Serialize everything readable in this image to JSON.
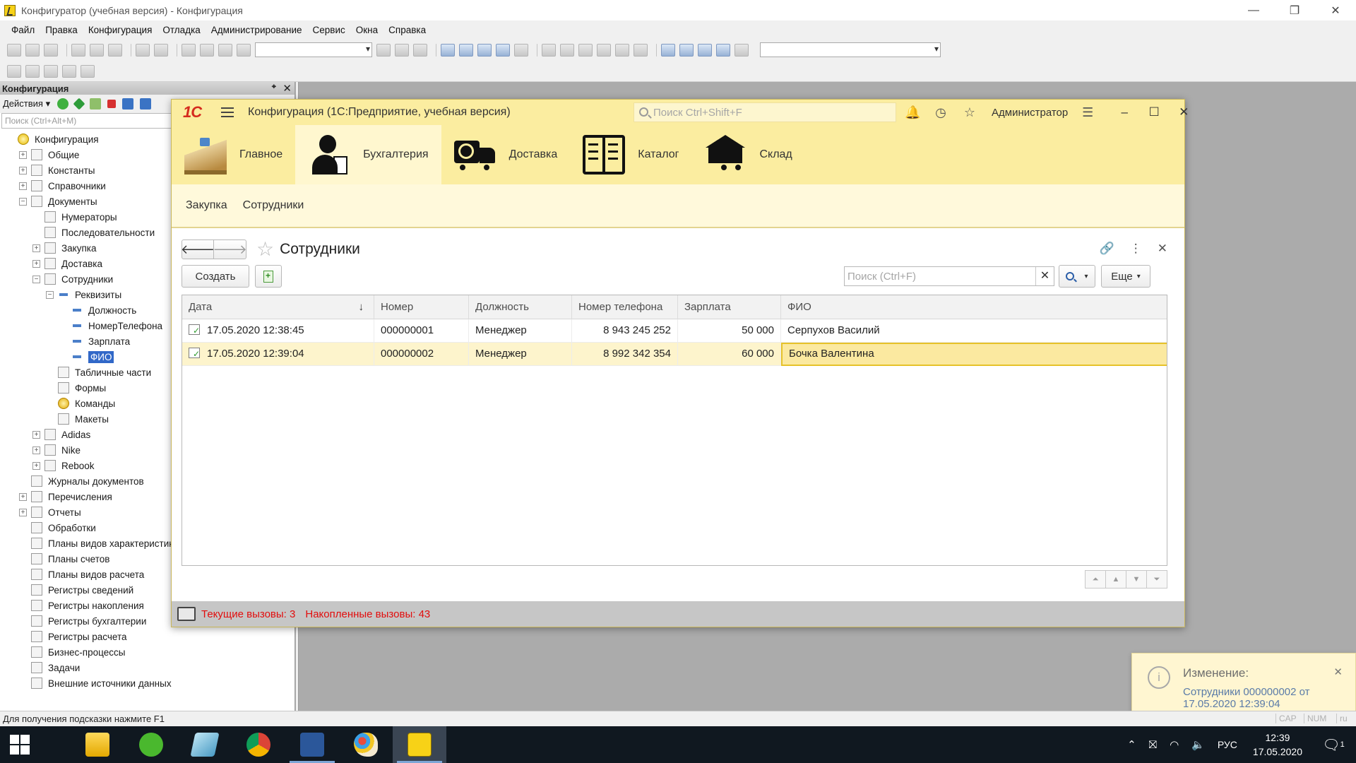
{
  "window": {
    "title": "Конфигуратор (учебная версия) - Конфигурация",
    "min": "—",
    "max": "❐",
    "close": "✕"
  },
  "menu": [
    "Файл",
    "Правка",
    "Конфигурация",
    "Отладка",
    "Администрирование",
    "Сервис",
    "Окна",
    "Справка"
  ],
  "config_panel": {
    "title": "Конфигурация",
    "actions_label": "Действия",
    "search_placeholder": "Поиск (Ctrl+Alt+M)",
    "tree": [
      {
        "label": "Конфигурация",
        "level": 0,
        "exp": "",
        "icon": "root"
      },
      {
        "label": "Общие",
        "level": 1,
        "exp": "+",
        "icon": "generic"
      },
      {
        "label": "Константы",
        "level": 1,
        "exp": "+",
        "icon": "generic"
      },
      {
        "label": "Справочники",
        "level": 1,
        "exp": "+",
        "icon": "generic"
      },
      {
        "label": "Документы",
        "level": 1,
        "exp": "−",
        "icon": "generic"
      },
      {
        "label": "Нумераторы",
        "level": 2,
        "exp": "",
        "icon": "generic"
      },
      {
        "label": "Последовательности",
        "level": 2,
        "exp": "",
        "icon": "generic"
      },
      {
        "label": "Закупка",
        "level": 2,
        "exp": "+",
        "icon": "generic"
      },
      {
        "label": "Доставка",
        "level": 2,
        "exp": "+",
        "icon": "generic"
      },
      {
        "label": "Сотрудники",
        "level": 2,
        "exp": "−",
        "icon": "generic"
      },
      {
        "label": "Реквизиты",
        "level": 3,
        "exp": "−",
        "icon": "dash"
      },
      {
        "label": "Должность",
        "level": 4,
        "exp": "",
        "icon": "dash"
      },
      {
        "label": "НомерТелефона",
        "level": 4,
        "exp": "",
        "icon": "dash"
      },
      {
        "label": "Зарплата",
        "level": 4,
        "exp": "",
        "icon": "dash"
      },
      {
        "label": "ФИО",
        "level": 4,
        "exp": "",
        "icon": "dash",
        "selected": true
      },
      {
        "label": "Табличные части",
        "level": 3,
        "exp": "",
        "icon": "generic"
      },
      {
        "label": "Формы",
        "level": 3,
        "exp": "",
        "icon": "generic"
      },
      {
        "label": "Команды",
        "level": 3,
        "exp": "",
        "icon": "cmd"
      },
      {
        "label": "Макеты",
        "level": 3,
        "exp": "",
        "icon": "generic"
      },
      {
        "label": "Adidas",
        "level": 2,
        "exp": "+",
        "icon": "generic"
      },
      {
        "label": "Nike",
        "level": 2,
        "exp": "+",
        "icon": "generic"
      },
      {
        "label": "Rebook",
        "level": 2,
        "exp": "+",
        "icon": "generic"
      },
      {
        "label": "Журналы документов",
        "level": 1,
        "exp": "",
        "icon": "generic"
      },
      {
        "label": "Перечисления",
        "level": 1,
        "exp": "+",
        "icon": "generic"
      },
      {
        "label": "Отчеты",
        "level": 1,
        "exp": "+",
        "icon": "generic"
      },
      {
        "label": "Обработки",
        "level": 1,
        "exp": "",
        "icon": "generic"
      },
      {
        "label": "Планы видов характеристик",
        "level": 1,
        "exp": "",
        "icon": "generic"
      },
      {
        "label": "Планы счетов",
        "level": 1,
        "exp": "",
        "icon": "generic"
      },
      {
        "label": "Планы видов расчета",
        "level": 1,
        "exp": "",
        "icon": "generic"
      },
      {
        "label": "Регистры сведений",
        "level": 1,
        "exp": "",
        "icon": "generic"
      },
      {
        "label": "Регистры накопления",
        "level": 1,
        "exp": "",
        "icon": "generic"
      },
      {
        "label": "Регистры бухгалтерии",
        "level": 1,
        "exp": "",
        "icon": "generic"
      },
      {
        "label": "Регистры расчета",
        "level": 1,
        "exp": "",
        "icon": "generic"
      },
      {
        "label": "Бизнес-процессы",
        "level": 1,
        "exp": "",
        "icon": "generic"
      },
      {
        "label": "Задачи",
        "level": 1,
        "exp": "",
        "icon": "generic"
      },
      {
        "label": "Внешние источники данных",
        "level": 1,
        "exp": "",
        "icon": "generic"
      }
    ]
  },
  "enterprise": {
    "logo": "1С",
    "title": "Конфигурация  (1С:Предприятие, учебная версия)",
    "search_placeholder": "Поиск Ctrl+Shift+F",
    "user": "Администратор",
    "sections": [
      {
        "label": "Главное",
        "icon": "home"
      },
      {
        "label": "Бухгалтерия",
        "icon": "acc",
        "active": true
      },
      {
        "label": "Доставка",
        "icon": "truck"
      },
      {
        "label": "Каталог",
        "icon": "book"
      },
      {
        "label": "Склад",
        "icon": "wh"
      }
    ],
    "subnav": [
      "Закупка",
      "Сотрудники"
    ],
    "form": {
      "title": "Сотрудники",
      "create_label": "Создать",
      "search_placeholder": "Поиск (Ctrl+F)",
      "more_label": "Еще",
      "columns": [
        "Дата",
        "Номер",
        "Должность",
        "Номер телефона",
        "Зарплата",
        "ФИО"
      ],
      "rows": [
        {
          "date": "17.05.2020 12:38:45",
          "number": "000000001",
          "position": "Менеджер",
          "phone": "8 943 245 252",
          "salary": "50 000",
          "fio": "Серпухов Василий"
        },
        {
          "date": "17.05.2020 12:39:04",
          "number": "000000002",
          "position": "Менеджер",
          "phone": "8 992 342 354",
          "salary": "60 000",
          "fio": "Бочка Валентина"
        }
      ]
    },
    "status": {
      "current_calls": "Текущие вызовы: 3",
      "accumulated_calls": "Накопленные вызовы: 43"
    }
  },
  "notification": {
    "title": "Изменение:",
    "text": "Сотрудники 000000002 от 17.05.2020 12:39:04"
  },
  "statusline": {
    "hint": "Для получения подсказки нажмите F1",
    "cap": "CAP",
    "num": "NUM",
    "lang": "ru"
  },
  "taskbar": {
    "lang": "РУС",
    "time": "12:39",
    "date": "17.05.2020",
    "notif_count": "1"
  }
}
